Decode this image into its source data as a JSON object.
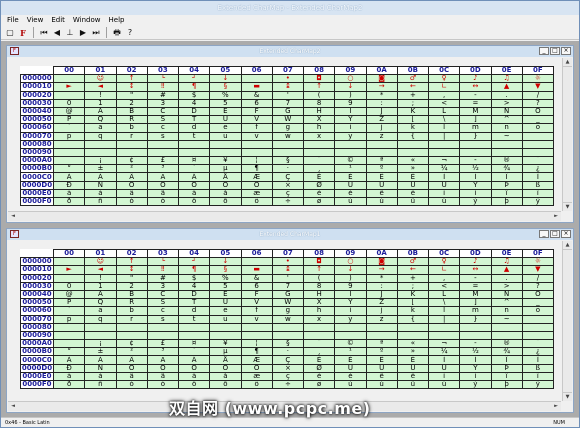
{
  "app": {
    "title": "Extended CharMap - Extended CharMap2",
    "menus": [
      "File",
      "View",
      "Edit",
      "Window",
      "Help"
    ],
    "toolbar": {
      "new": "▢",
      "font": "F",
      "first": "⏮",
      "prev": "◀",
      "home": "⊥",
      "next": "▶",
      "last": "⏭",
      "print": "🖶",
      "help": "?"
    }
  },
  "windows": [
    {
      "id": "w1",
      "title": "Extended CharMap2"
    },
    {
      "id": "w2",
      "title": "Extended CharMap1"
    }
  ],
  "columns": [
    "00",
    "01",
    "02",
    "03",
    "04",
    "05",
    "06",
    "07",
    "08",
    "09",
    "0A",
    "0B",
    "0C",
    "0D",
    "0E",
    "0F"
  ],
  "rows": [
    {
      "label": "000000",
      "ctrl": true,
      "cells": [
        "",
        "☺",
        "↑",
        "└",
        "┘",
        "↓",
        "",
        "•",
        "◘",
        "○",
        "◙",
        "♂",
        "♀",
        "♪",
        "♫",
        "☼"
      ]
    },
    {
      "label": "000010",
      "ctrl": true,
      "cells": [
        "►",
        "◄",
        "↕",
        "‼",
        "¶",
        "§",
        "▬",
        "↨",
        "↑",
        "↓",
        "→",
        "←",
        "∟",
        "↔",
        "▲",
        "▼"
      ]
    },
    {
      "label": "000020",
      "ctrl": false,
      "cells": [
        "",
        "!",
        "\"",
        "#",
        "$",
        "%",
        "&",
        "'",
        "(",
        ")",
        "*",
        "+",
        ",",
        "-",
        ".",
        "/"
      ]
    },
    {
      "label": "000030",
      "ctrl": false,
      "cells": [
        "0",
        "1",
        "2",
        "3",
        "4",
        "5",
        "6",
        "7",
        "8",
        "9",
        ":",
        ";",
        "<",
        "=",
        ">",
        "?"
      ]
    },
    {
      "label": "000040",
      "ctrl": false,
      "cells": [
        "@",
        "A",
        "B",
        "C",
        "D",
        "E",
        "F",
        "G",
        "H",
        "I",
        "J",
        "K",
        "L",
        "M",
        "N",
        "O"
      ]
    },
    {
      "label": "000050",
      "ctrl": false,
      "cells": [
        "P",
        "Q",
        "R",
        "S",
        "T",
        "U",
        "V",
        "W",
        "X",
        "Y",
        "Z",
        "[",
        "\\",
        "]",
        "^",
        "_"
      ]
    },
    {
      "label": "000060",
      "ctrl": false,
      "cells": [
        "`",
        "a",
        "b",
        "c",
        "d",
        "e",
        "f",
        "g",
        "h",
        "i",
        "j",
        "k",
        "l",
        "m",
        "n",
        "o"
      ]
    },
    {
      "label": "000070",
      "ctrl": false,
      "cells": [
        "p",
        "q",
        "r",
        "s",
        "t",
        "u",
        "v",
        "w",
        "x",
        "y",
        "z",
        "{",
        "|",
        "}",
        "~",
        ""
      ]
    },
    {
      "label": "000080",
      "ctrl": false,
      "cells": [
        "",
        "",
        "",
        "",
        "",
        "",
        "",
        "",
        "",
        "",
        "",
        "",
        "",
        "",
        "",
        ""
      ]
    },
    {
      "label": "000090",
      "ctrl": false,
      "cells": [
        "",
        "",
        "",
        "",
        "",
        "",
        "",
        "",
        "",
        "",
        "",
        "",
        "",
        "",
        "",
        ""
      ]
    },
    {
      "label": "0000A0",
      "ctrl": false,
      "cells": [
        "",
        "¡",
        "¢",
        "£",
        "¤",
        "¥",
        "¦",
        "§",
        "¨",
        "©",
        "ª",
        "«",
        "¬",
        "-",
        "®",
        "¯"
      ]
    },
    {
      "label": "0000B0",
      "ctrl": false,
      "cells": [
        "°",
        "±",
        "²",
        "³",
        "´",
        "µ",
        "¶",
        "·",
        "¸",
        "¹",
        "º",
        "»",
        "¼",
        "½",
        "¾",
        "¿"
      ]
    },
    {
      "label": "0000C0",
      "ctrl": false,
      "cells": [
        "À",
        "Á",
        "Â",
        "Ã",
        "Ä",
        "Å",
        "Æ",
        "Ç",
        "È",
        "É",
        "Ê",
        "Ë",
        "Ì",
        "Í",
        "Î",
        "Ï"
      ]
    },
    {
      "label": "0000D0",
      "ctrl": false,
      "cells": [
        "Ð",
        "Ñ",
        "Ò",
        "Ó",
        "Ô",
        "Õ",
        "Ö",
        "×",
        "Ø",
        "Ù",
        "Ú",
        "Û",
        "Ü",
        "Ý",
        "Þ",
        "ß"
      ]
    },
    {
      "label": "0000E0",
      "ctrl": false,
      "cells": [
        "à",
        "á",
        "â",
        "ã",
        "ä",
        "å",
        "æ",
        "ç",
        "è",
        "é",
        "ê",
        "ë",
        "ì",
        "í",
        "î",
        "ï"
      ]
    },
    {
      "label": "0000F0",
      "ctrl": false,
      "cells": [
        "ð",
        "ñ",
        "ò",
        "ó",
        "ô",
        "õ",
        "ö",
        "÷",
        "ø",
        "ù",
        "ú",
        "û",
        "ü",
        "ý",
        "þ",
        "ÿ"
      ]
    }
  ],
  "status": {
    "left": "0x46 - Basic Latin",
    "right": "NUM"
  },
  "watermark": "双自网 (www.pcpc.me)",
  "colors": {
    "cell": "#d2f6d2",
    "header_text": "#1c1c9a",
    "control_glyph": "#d00000"
  }
}
